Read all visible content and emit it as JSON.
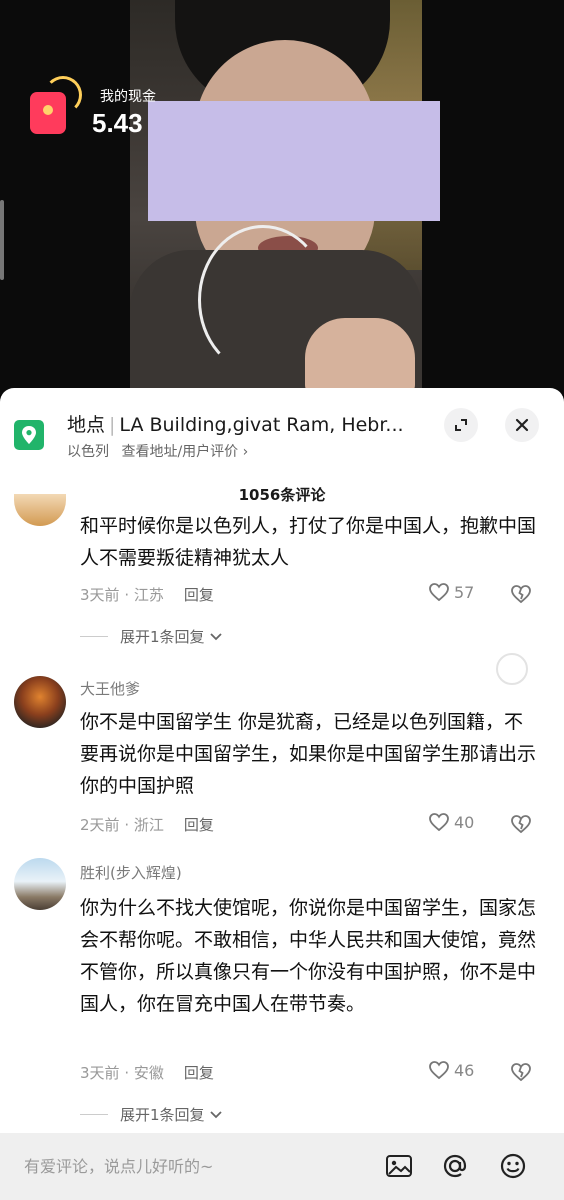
{
  "overlay": {
    "money_label": "我的现金",
    "money_value": "5.43",
    "money_icon": "red-envelope-icon"
  },
  "location": {
    "label": "地点",
    "name": "LA Building,givat Ram, Hebr...",
    "country": "以色列",
    "link": "查看地址/用户评价 ›",
    "icon": "map-pin-icon"
  },
  "comments_count": "1056条评论",
  "comments": [
    {
      "user": "",
      "text": "和平时候你是以色列人，打仗了你是中国人，抱歉中国人不需要叛徒精神犹太人",
      "time": "3天前",
      "region": "江苏",
      "reply": "回复",
      "likes": "57",
      "expand": "展开1条回复"
    },
    {
      "user": "大王他爹",
      "text": "你不是中国留学生 你是犹裔，已经是以色列国籍，不要再说你是中国留学生，如果你是中国留学生那请出示你的中国护照",
      "time": "2天前",
      "region": "浙江",
      "reply": "回复",
      "likes": "40",
      "expand": ""
    },
    {
      "user": "胜利(步入辉煌)",
      "text": "你为什么不找大使馆呢，你说你是中国留学生，国家怎会不帮你呢。不敢相信，中华人民共和国大使馆，竟然不管你，所以真像只有一个你没有中国护照，你不是中国人，你在冒充中国人在带节奏。",
      "time": "3天前",
      "region": "安徽",
      "reply": "回复",
      "likes": "46",
      "expand": "展开1条回复"
    }
  ],
  "input": {
    "placeholder": "有爱评论，说点儿好听的~"
  },
  "colors": {
    "accent_green": "#21b46a",
    "envelope_red": "#ff3b5c",
    "mask": "#c6bde8"
  }
}
